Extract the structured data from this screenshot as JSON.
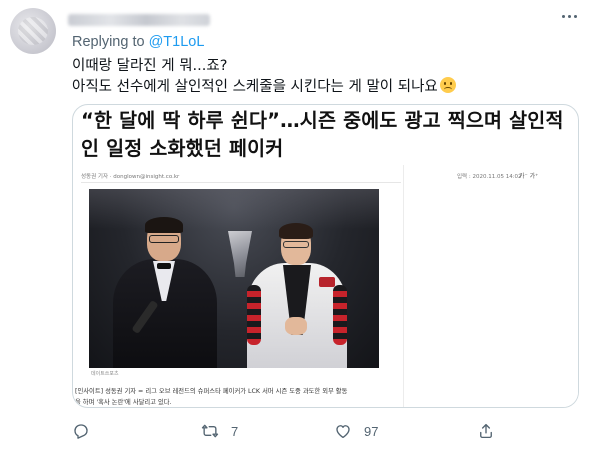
{
  "tweet": {
    "replying_prefix": "Replying to",
    "replying_handle": "@T1LoL",
    "text_line1": "이때랑 달라진 게 뭐...죠?",
    "text_line2": "아직도 선수에게 살인적인 스케줄을 시킨다는 게 말이 되나요",
    "emoji": "slightly-frowning-face"
  },
  "card": {
    "headline": "“한 달에 딱 하루 쉰다”…시즌 중에도 광고 찍으며 살인적인 일정 소화했던 페이커",
    "byline": "성동권 기자 · donglown@insight.co.kr",
    "date": "입력 : 2020.11.05 14:02",
    "font_controls": "가⁻ 가⁺",
    "photo_caption": "데이트쓰포츠",
    "body_line1": "[인사이트] 성동권 기자 = 리그 오브 레전드의 슈퍼스타 페이커가 LCK 서머 시즌 도중 과도한 외부 활동",
    "body_line2": "을 하며 '혹사 논란'에 사달리고 있다."
  },
  "actions": {
    "reply_count": "",
    "retweet_count": "7",
    "like_count": "97"
  },
  "colors": {
    "text": "#0f1419",
    "secondary": "#536471",
    "link": "#1d9bf0",
    "card_border": "#cfd9de"
  }
}
